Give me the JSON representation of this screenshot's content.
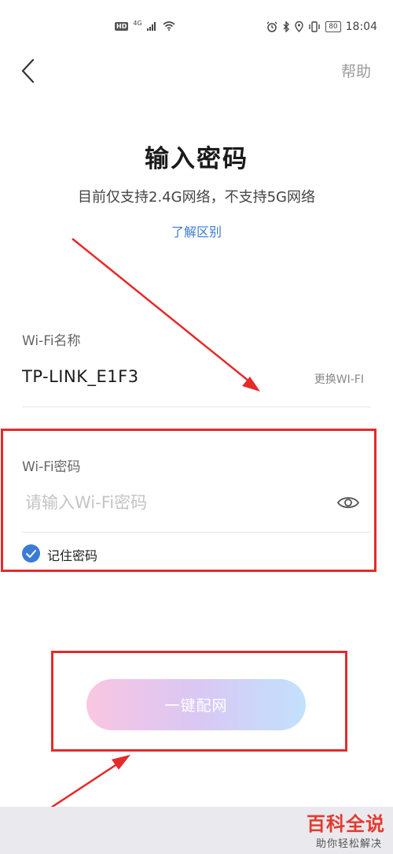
{
  "status_bar": {
    "hd": "HD",
    "network": "4G",
    "battery": "80",
    "time": "18:04"
  },
  "nav": {
    "help": "帮助"
  },
  "header": {
    "title": "输入密码",
    "subtitle": "目前仅支持2.4G网络，不支持5G网络",
    "learn_link": "了解区别"
  },
  "wifi_name": {
    "label": "Wi-Fi名称",
    "value": "TP-LINK_E1F3",
    "change": "更换WI-FI"
  },
  "wifi_password": {
    "label": "Wi-Fi密码",
    "placeholder": "请输入Wi-Fi密码",
    "value": ""
  },
  "remember": {
    "label": "记住密码",
    "checked": true
  },
  "connect_button": {
    "label": "一键配网"
  },
  "watermark": {
    "main": "百科全说",
    "sub": "助你轻松解决"
  },
  "colors": {
    "accent": "#3a7bd5",
    "annotation": "#e52a2a"
  }
}
